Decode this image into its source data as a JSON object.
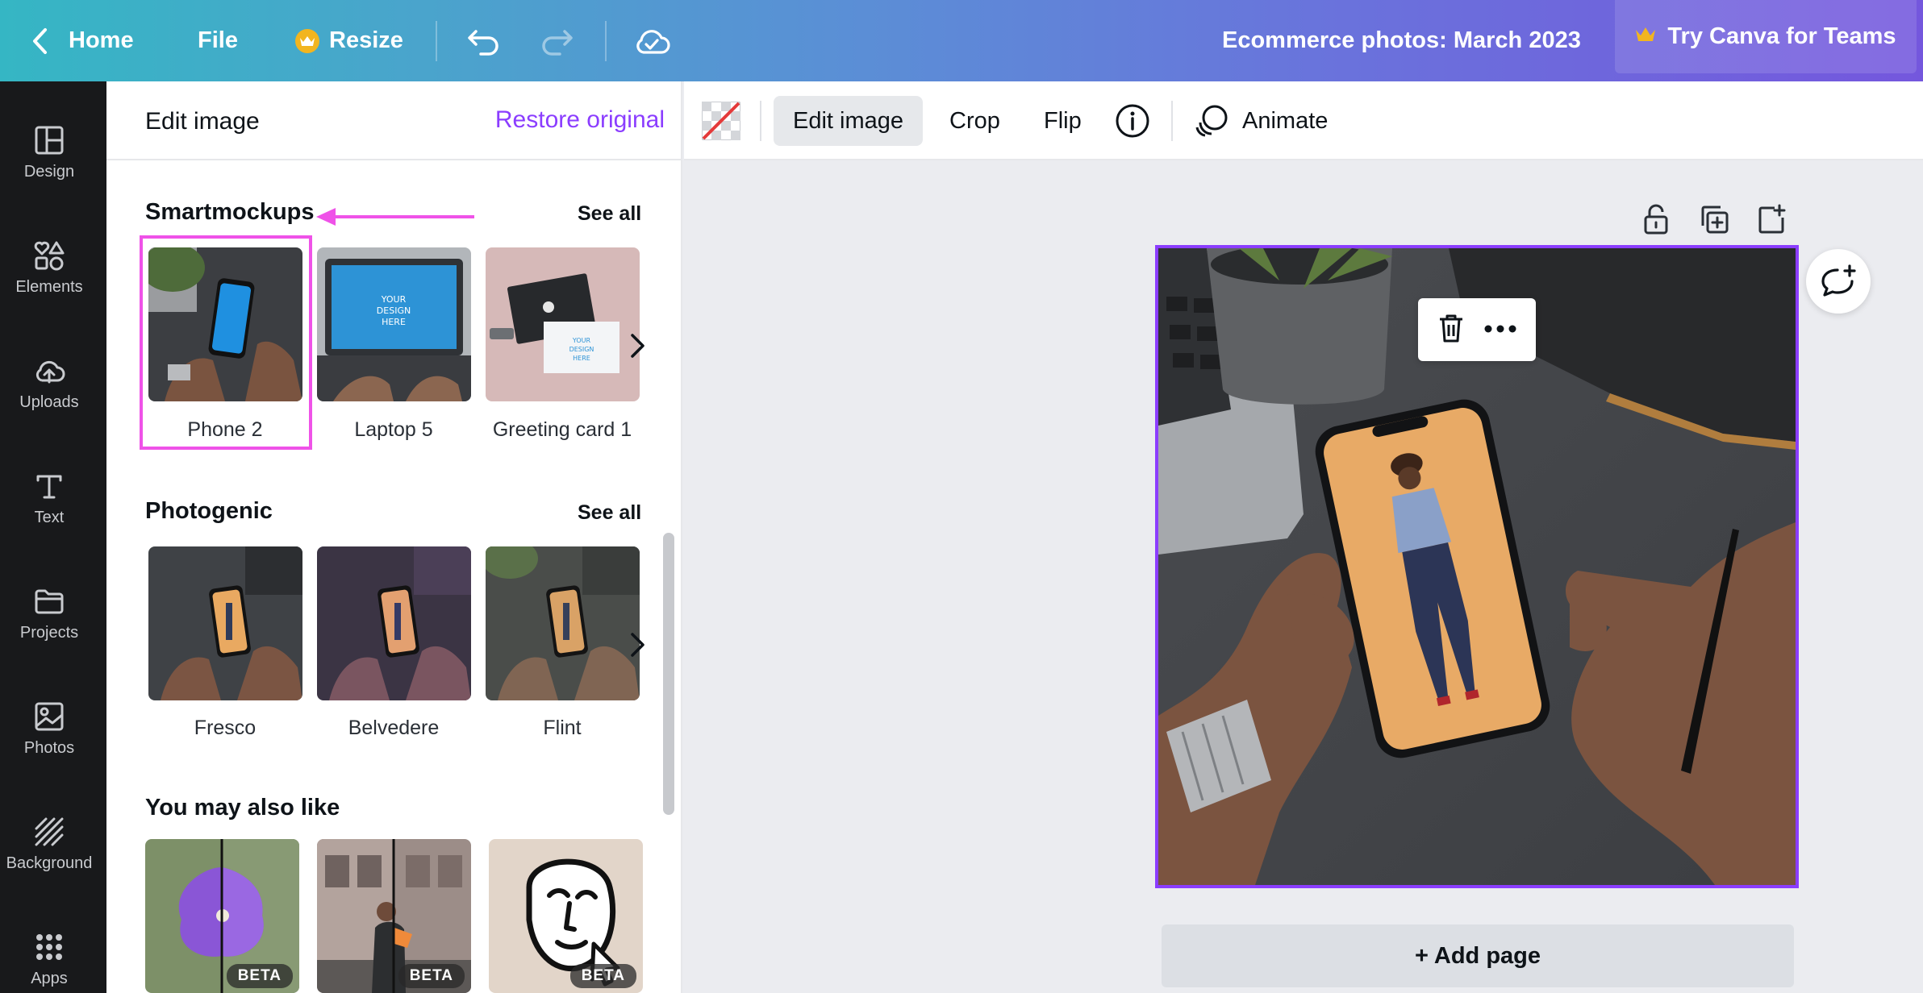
{
  "topbar": {
    "home": "Home",
    "file": "File",
    "resize": "Resize",
    "doc_title": "Ecommerce photos: March 2023",
    "teams": "Try Canva for Teams"
  },
  "rail": [
    {
      "label": "Design",
      "icon": "design-icon"
    },
    {
      "label": "Elements",
      "icon": "elements-icon"
    },
    {
      "label": "Uploads",
      "icon": "uploads-icon"
    },
    {
      "label": "Text",
      "icon": "text-icon"
    },
    {
      "label": "Projects",
      "icon": "projects-icon"
    },
    {
      "label": "Photos",
      "icon": "photos-icon"
    },
    {
      "label": "Background",
      "icon": "background-icon"
    },
    {
      "label": "Apps",
      "icon": "apps-icon"
    }
  ],
  "panel": {
    "title": "Edit image",
    "restore": "Restore original",
    "smartmockups": {
      "title": "Smartmockups",
      "see_all": "See all",
      "items": [
        "Phone 2",
        "Laptop 5",
        "Greeting card 1"
      ],
      "mockup_text": "YOUR DESIGN HERE"
    },
    "photogenic": {
      "title": "Photogenic",
      "see_all": "See all",
      "items": [
        "Fresco",
        "Belvedere",
        "Flint"
      ]
    },
    "also_like": {
      "title": "You may also like",
      "badge": "BETA"
    }
  },
  "toolbar": {
    "edit_image": "Edit image",
    "crop": "Crop",
    "flip": "Flip",
    "animate": "Animate"
  },
  "canvas": {
    "add_page": "+ Add page"
  },
  "colors": {
    "accent": "#8b3dff",
    "highlight": "#ef52e8",
    "rail_bg": "#18191b",
    "canvas_bg": "#ebecf0"
  }
}
